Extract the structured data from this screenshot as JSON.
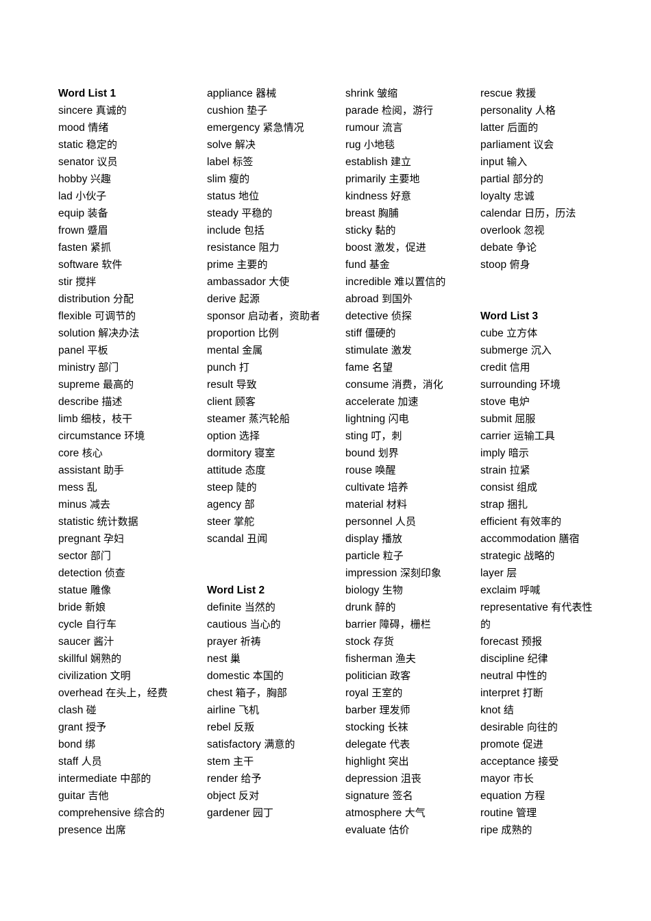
{
  "document": {
    "type": "vocabulary-word-list",
    "page_background": "#ffffff",
    "text_color": "#000000",
    "column_count": 4
  },
  "headings": {
    "list1": "Word List 1",
    "list2": "Word List 2",
    "list3": "Word List 3"
  },
  "columns": [
    {
      "id": "column-1",
      "blocks": [
        {
          "kind": "heading",
          "text": "Word List 1"
        },
        {
          "kind": "entry",
          "term": "sincere",
          "gloss": "真诚的"
        },
        {
          "kind": "entry",
          "term": "mood",
          "gloss": "情绪"
        },
        {
          "kind": "entry",
          "term": "static",
          "gloss": "稳定的"
        },
        {
          "kind": "entry",
          "term": "senator",
          "gloss": "议员"
        },
        {
          "kind": "entry",
          "term": "hobby",
          "gloss": "兴趣"
        },
        {
          "kind": "entry",
          "term": "lad",
          "gloss": "小伙子"
        },
        {
          "kind": "entry",
          "term": "equip",
          "gloss": "装备"
        },
        {
          "kind": "entry",
          "term": "frown",
          "gloss": "蹙眉"
        },
        {
          "kind": "entry",
          "term": "fasten",
          "gloss": "紧抓"
        },
        {
          "kind": "entry",
          "term": "software",
          "gloss": "软件"
        },
        {
          "kind": "entry",
          "term": "stir",
          "gloss": "搅拌"
        },
        {
          "kind": "entry",
          "term": "distribution",
          "gloss": "分配"
        },
        {
          "kind": "entry",
          "term": "flexible",
          "gloss": "可调节的"
        },
        {
          "kind": "entry",
          "term": "solution",
          "gloss": "解决办法"
        },
        {
          "kind": "entry",
          "term": "panel",
          "gloss": "平板"
        },
        {
          "kind": "entry",
          "term": "ministry",
          "gloss": "部门"
        },
        {
          "kind": "entry",
          "term": "supreme",
          "gloss": "最高的"
        },
        {
          "kind": "entry",
          "term": "describe",
          "gloss": "描述"
        },
        {
          "kind": "entry",
          "term": "limb",
          "gloss": "细枝，枝干"
        },
        {
          "kind": "entry",
          "term": "circumstance",
          "gloss": "环境"
        },
        {
          "kind": "entry",
          "term": "core",
          "gloss": "核心"
        },
        {
          "kind": "entry",
          "term": "assistant",
          "gloss": "助手"
        },
        {
          "kind": "entry",
          "term": "mess",
          "gloss": "乱"
        },
        {
          "kind": "entry",
          "term": "minus",
          "gloss": "减去"
        },
        {
          "kind": "entry",
          "term": "statistic",
          "gloss": "统计数据"
        },
        {
          "kind": "entry",
          "term": "pregnant",
          "gloss": "孕妇"
        },
        {
          "kind": "entry",
          "term": "sector",
          "gloss": "部门"
        },
        {
          "kind": "entry",
          "term": "detection",
          "gloss": "侦查"
        },
        {
          "kind": "entry",
          "term": "statue",
          "gloss": "雕像"
        },
        {
          "kind": "entry",
          "term": "bride",
          "gloss": "新娘"
        },
        {
          "kind": "entry",
          "term": "cycle",
          "gloss": "自行车"
        },
        {
          "kind": "entry",
          "term": "saucer",
          "gloss": "酱汁"
        },
        {
          "kind": "entry",
          "term": "skillful",
          "gloss": "娴熟的"
        },
        {
          "kind": "entry",
          "term": "civilization",
          "gloss": "文明"
        },
        {
          "kind": "entry",
          "term": "overhead",
          "gloss": "在头上，经费"
        },
        {
          "kind": "entry",
          "term": "clash",
          "gloss": "碰"
        },
        {
          "kind": "entry",
          "term": "grant",
          "gloss": "授予"
        },
        {
          "kind": "entry",
          "term": "bond",
          "gloss": "绑"
        },
        {
          "kind": "entry",
          "term": "staff",
          "gloss": "人员"
        },
        {
          "kind": "entry",
          "term": "intermediate",
          "gloss": "中部的"
        },
        {
          "kind": "entry",
          "term": "guitar",
          "gloss": "吉他"
        },
        {
          "kind": "entry",
          "term": "comprehensive",
          "gloss": "综合的"
        },
        {
          "kind": "entry",
          "term": "presence",
          "gloss": "出席"
        }
      ]
    },
    {
      "id": "column-2",
      "blocks": [
        {
          "kind": "entry",
          "term": "appliance",
          "gloss": "器械"
        },
        {
          "kind": "entry",
          "term": "cushion",
          "gloss": "垫子"
        },
        {
          "kind": "entry",
          "term": "emergency",
          "gloss": "紧急情况"
        },
        {
          "kind": "entry",
          "term": "solve",
          "gloss": "解决"
        },
        {
          "kind": "entry",
          "term": "label",
          "gloss": "标签"
        },
        {
          "kind": "entry",
          "term": "slim",
          "gloss": "瘦的"
        },
        {
          "kind": "entry",
          "term": "status",
          "gloss": "地位"
        },
        {
          "kind": "entry",
          "term": "steady",
          "gloss": "平稳的"
        },
        {
          "kind": "entry",
          "term": "include",
          "gloss": "包括"
        },
        {
          "kind": "entry",
          "term": "resistance",
          "gloss": "阻力"
        },
        {
          "kind": "entry",
          "term": "prime",
          "gloss": "主要的"
        },
        {
          "kind": "entry",
          "term": "ambassador",
          "gloss": "大使"
        },
        {
          "kind": "entry",
          "term": "derive",
          "gloss": "起源"
        },
        {
          "kind": "entry",
          "term": "sponsor",
          "gloss": "启动者，资助者",
          "wraps": true
        },
        {
          "kind": "entry",
          "term": "proportion",
          "gloss": "比例"
        },
        {
          "kind": "entry",
          "term": "mental",
          "gloss": "金属"
        },
        {
          "kind": "entry",
          "term": "punch",
          "gloss": "打"
        },
        {
          "kind": "entry",
          "term": "result",
          "gloss": "导致"
        },
        {
          "kind": "entry",
          "term": "client",
          "gloss": "顾客"
        },
        {
          "kind": "entry",
          "term": "steamer",
          "gloss": "蒸汽轮船"
        },
        {
          "kind": "entry",
          "term": "option",
          "gloss": "选择"
        },
        {
          "kind": "entry",
          "term": "dormitory",
          "gloss": "寝室"
        },
        {
          "kind": "entry",
          "term": "attitude",
          "gloss": "态度"
        },
        {
          "kind": "entry",
          "term": "steep",
          "gloss": "陡的"
        },
        {
          "kind": "entry",
          "term": "agency",
          "gloss": "部"
        },
        {
          "kind": "entry",
          "term": "steer",
          "gloss": "掌舵"
        },
        {
          "kind": "entry",
          "term": "scandal",
          "gloss": "丑闻"
        },
        {
          "kind": "spacer",
          "lines": 2
        },
        {
          "kind": "heading",
          "text": "Word List 2"
        },
        {
          "kind": "entry",
          "term": "definite",
          "gloss": "当然的"
        },
        {
          "kind": "entry",
          "term": "cautious",
          "gloss": "当心的"
        },
        {
          "kind": "entry",
          "term": "prayer",
          "gloss": "祈祷"
        },
        {
          "kind": "entry",
          "term": "nest",
          "gloss": "巢"
        },
        {
          "kind": "entry",
          "term": "domestic",
          "gloss": "本国的"
        },
        {
          "kind": "entry",
          "term": "chest",
          "gloss": "箱子，胸部"
        },
        {
          "kind": "entry",
          "term": "airline",
          "gloss": "飞机"
        },
        {
          "kind": "entry",
          "term": "rebel",
          "gloss": "反叛"
        },
        {
          "kind": "entry",
          "term": "satisfactory",
          "gloss": "满意的"
        },
        {
          "kind": "entry",
          "term": "stem",
          "gloss": "主干"
        },
        {
          "kind": "entry",
          "term": "render",
          "gloss": "给予"
        },
        {
          "kind": "entry",
          "term": "object",
          "gloss": "反对"
        },
        {
          "kind": "entry",
          "term": "gardener",
          "gloss": "园丁"
        }
      ]
    },
    {
      "id": "column-3",
      "blocks": [
        {
          "kind": "entry",
          "term": "shrink",
          "gloss": "皱缩"
        },
        {
          "kind": "entry",
          "term": "parade",
          "gloss": "检阅，游行"
        },
        {
          "kind": "entry",
          "term": "rumour",
          "gloss": "流言"
        },
        {
          "kind": "entry",
          "term": "rug",
          "gloss": "小地毯"
        },
        {
          "kind": "entry",
          "term": "establish",
          "gloss": "建立"
        },
        {
          "kind": "entry",
          "term": "primarily",
          "gloss": "主要地"
        },
        {
          "kind": "entry",
          "term": "kindness",
          "gloss": "好意"
        },
        {
          "kind": "entry",
          "term": "breast",
          "gloss": "胸脯"
        },
        {
          "kind": "entry",
          "term": "sticky",
          "gloss": "黏的"
        },
        {
          "kind": "entry",
          "term": "boost",
          "gloss": "激发，促进"
        },
        {
          "kind": "entry",
          "term": "fund",
          "gloss": "基金"
        },
        {
          "kind": "entry",
          "term": "incredible",
          "gloss": "难以置信的"
        },
        {
          "kind": "entry",
          "term": "abroad",
          "gloss": "到国外"
        },
        {
          "kind": "entry",
          "term": "detective",
          "gloss": "侦探"
        },
        {
          "kind": "entry",
          "term": "stiff",
          "gloss": "僵硬的"
        },
        {
          "kind": "entry",
          "term": "stimulate",
          "gloss": "激发"
        },
        {
          "kind": "entry",
          "term": "fame",
          "gloss": "名望"
        },
        {
          "kind": "entry",
          "term": "consume",
          "gloss": "消费，消化"
        },
        {
          "kind": "entry",
          "term": "accelerate",
          "gloss": "加速"
        },
        {
          "kind": "entry",
          "term": "lightning",
          "gloss": "闪电"
        },
        {
          "kind": "entry",
          "term": "sting",
          "gloss": "叮，刺"
        },
        {
          "kind": "entry",
          "term": "bound",
          "gloss": "划界"
        },
        {
          "kind": "entry",
          "term": "rouse",
          "gloss": "唤醒"
        },
        {
          "kind": "entry",
          "term": "cultivate",
          "gloss": "培养"
        },
        {
          "kind": "entry",
          "term": "material",
          "gloss": "材料"
        },
        {
          "kind": "entry",
          "term": "personnel",
          "gloss": "人员"
        },
        {
          "kind": "entry",
          "term": "display",
          "gloss": "播放"
        },
        {
          "kind": "entry",
          "term": "particle",
          "gloss": "粒子"
        },
        {
          "kind": "entry",
          "term": "impression",
          "gloss": "深刻印象"
        },
        {
          "kind": "entry",
          "term": "biology",
          "gloss": "生物"
        },
        {
          "kind": "entry",
          "term": "drunk",
          "gloss": "醉的"
        },
        {
          "kind": "entry",
          "term": "barrier",
          "gloss": "障碍，栅栏"
        },
        {
          "kind": "entry",
          "term": "stock",
          "gloss": "存货"
        },
        {
          "kind": "entry",
          "term": "fisherman",
          "gloss": "渔夫"
        },
        {
          "kind": "entry",
          "term": "politician",
          "gloss": "政客"
        },
        {
          "kind": "entry",
          "term": "royal",
          "gloss": "王室的"
        },
        {
          "kind": "entry",
          "term": "barber",
          "gloss": "理发师"
        },
        {
          "kind": "entry",
          "term": "stocking",
          "gloss": "长袜"
        },
        {
          "kind": "entry",
          "term": "delegate",
          "gloss": "代表"
        },
        {
          "kind": "entry",
          "term": "highlight",
          "gloss": "突出"
        },
        {
          "kind": "entry",
          "term": "depression",
          "gloss": "沮丧"
        },
        {
          "kind": "entry",
          "term": "signature",
          "gloss": "签名"
        },
        {
          "kind": "entry",
          "term": "atmosphere",
          "gloss": "大气"
        },
        {
          "kind": "entry",
          "term": "evaluate",
          "gloss": "估价"
        }
      ]
    },
    {
      "id": "column-4",
      "blocks": [
        {
          "kind": "entry",
          "term": "rescue",
          "gloss": "救援"
        },
        {
          "kind": "entry",
          "term": "personality",
          "gloss": "人格"
        },
        {
          "kind": "entry",
          "term": "latter",
          "gloss": "后面的"
        },
        {
          "kind": "entry",
          "term": "parliament",
          "gloss": "议会"
        },
        {
          "kind": "entry",
          "term": "input",
          "gloss": "输入"
        },
        {
          "kind": "entry",
          "term": "partial",
          "gloss": "部分的"
        },
        {
          "kind": "entry",
          "term": "loyalty",
          "gloss": "忠诚"
        },
        {
          "kind": "entry",
          "term": "calendar",
          "gloss": "日历，历法"
        },
        {
          "kind": "entry",
          "term": "overlook",
          "gloss": "忽视"
        },
        {
          "kind": "entry",
          "term": "debate",
          "gloss": "争论"
        },
        {
          "kind": "entry",
          "term": "stoop",
          "gloss": "俯身"
        },
        {
          "kind": "spacer",
          "lines": 2
        },
        {
          "kind": "heading",
          "text": "Word List 3"
        },
        {
          "kind": "entry",
          "term": "cube",
          "gloss": "立方体"
        },
        {
          "kind": "entry",
          "term": "submerge",
          "gloss": "沉入"
        },
        {
          "kind": "entry",
          "term": "credit",
          "gloss": "信用"
        },
        {
          "kind": "entry",
          "term": "surrounding",
          "gloss": "环境"
        },
        {
          "kind": "entry",
          "term": "stove",
          "gloss": "电炉"
        },
        {
          "kind": "entry",
          "term": "submit",
          "gloss": "屈服"
        },
        {
          "kind": "entry",
          "term": "carrier",
          "gloss": "运输工具"
        },
        {
          "kind": "entry",
          "term": "imply",
          "gloss": "暗示"
        },
        {
          "kind": "entry",
          "term": "strain",
          "gloss": "拉紧"
        },
        {
          "kind": "entry",
          "term": "consist",
          "gloss": "组成"
        },
        {
          "kind": "entry",
          "term": "strap",
          "gloss": "捆扎"
        },
        {
          "kind": "entry",
          "term": "efficient",
          "gloss": "有效率的"
        },
        {
          "kind": "entry",
          "term": "accommodation",
          "gloss": "膳宿"
        },
        {
          "kind": "entry",
          "term": "strategic",
          "gloss": "战略的"
        },
        {
          "kind": "entry",
          "term": "layer",
          "gloss": "层"
        },
        {
          "kind": "entry",
          "term": "exclaim",
          "gloss": "呼喊"
        },
        {
          "kind": "entry",
          "term": "representative",
          "gloss": "有代表性的",
          "wraps": true
        },
        {
          "kind": "entry",
          "term": "forecast",
          "gloss": "预报"
        },
        {
          "kind": "entry",
          "term": "discipline",
          "gloss": "纪律"
        },
        {
          "kind": "entry",
          "term": "neutral",
          "gloss": "中性的"
        },
        {
          "kind": "entry",
          "term": "interpret",
          "gloss": "打断"
        },
        {
          "kind": "entry",
          "term": "knot",
          "gloss": "结"
        },
        {
          "kind": "entry",
          "term": "desirable",
          "gloss": "向往的"
        },
        {
          "kind": "entry",
          "term": "promote",
          "gloss": "促进"
        },
        {
          "kind": "entry",
          "term": "acceptance",
          "gloss": "接受"
        },
        {
          "kind": "entry",
          "term": "mayor",
          "gloss": "市长"
        },
        {
          "kind": "entry",
          "term": "equation",
          "gloss": "方程"
        },
        {
          "kind": "entry",
          "term": "routine",
          "gloss": "管理"
        },
        {
          "kind": "entry",
          "term": "ripe",
          "gloss": "成熟的"
        }
      ]
    }
  ]
}
